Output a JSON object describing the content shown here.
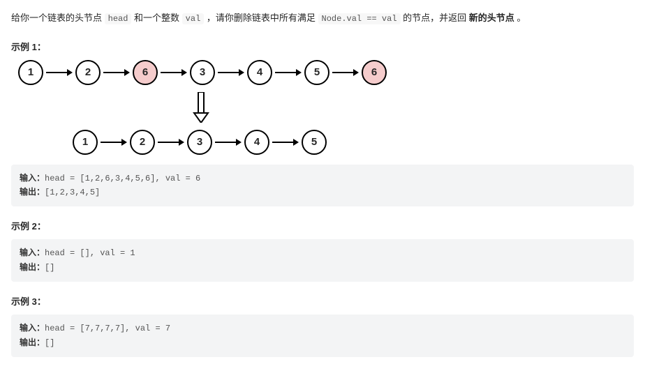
{
  "intro": {
    "p1": "给你一个链表的头节点 ",
    "c1": "head",
    "p2": " 和一个整数 ",
    "c2": "val",
    "p3": " ，请你删除链表中所有满足 ",
    "c3": "Node.val == val",
    "p4": " 的节点，并返回 ",
    "b1": "新的头节点",
    "p5": " 。"
  },
  "examples": [
    {
      "title": "示例 1：",
      "diagram": {
        "row1": [
          {
            "v": "1",
            "hl": false
          },
          {
            "v": "2",
            "hl": false
          },
          {
            "v": "6",
            "hl": true
          },
          {
            "v": "3",
            "hl": false
          },
          {
            "v": "4",
            "hl": false
          },
          {
            "v": "5",
            "hl": false
          },
          {
            "v": "6",
            "hl": true
          }
        ],
        "row2": [
          {
            "v": "1",
            "hl": false
          },
          {
            "v": "2",
            "hl": false
          },
          {
            "v": "3",
            "hl": false
          },
          {
            "v": "4",
            "hl": false
          },
          {
            "v": "5",
            "hl": false
          }
        ]
      },
      "input_label": "输入：",
      "input": "head = [1,2,6,3,4,5,6], val = 6",
      "output_label": "输出：",
      "output": "[1,2,3,4,5]"
    },
    {
      "title": "示例 2：",
      "input_label": "输入：",
      "input": "head = [], val = 1",
      "output_label": "输出：",
      "output": "[]"
    },
    {
      "title": "示例 3：",
      "input_label": "输入：",
      "input": "head = [7,7,7,7], val = 7",
      "output_label": "输出：",
      "output": "[]"
    }
  ]
}
